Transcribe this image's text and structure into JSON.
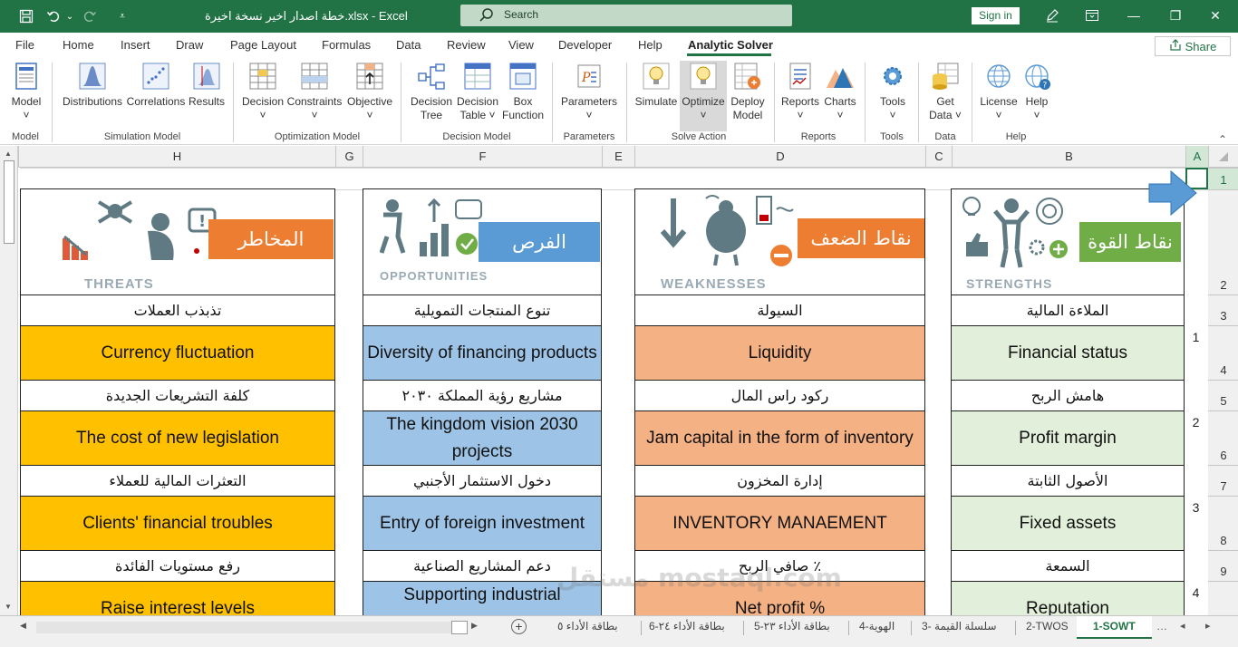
{
  "titlebar": {
    "title": "خطة اصدار اخير نسخة اخيرة.xlsx  -  Excel",
    "search_placeholder": "Search",
    "signin_label": "Sign in",
    "minimize": "—",
    "restore": "❐",
    "close": "✕"
  },
  "tabs": [
    "File",
    "Home",
    "Insert",
    "Draw",
    "Page Layout",
    "Formulas",
    "Data",
    "Review",
    "View",
    "Developer",
    "Help",
    "Analytic Solver"
  ],
  "active_tab": "Analytic Solver",
  "share_label": "Share",
  "ribbon": {
    "model": "Model",
    "distributions": "Distributions",
    "correlations": "Correlations",
    "results": "Results",
    "decision": "Decision",
    "constraints": "Constraints",
    "objective": "Objective",
    "decision_tree_1": "Decision",
    "decision_tree_2": "Tree",
    "decision_table_1": "Decision",
    "decision_table_2": "Table ˅",
    "box_function_1": "Box",
    "box_function_2": "Function",
    "parameters": "Parameters",
    "simulate": "Simulate",
    "optimize": "Optimize",
    "deploy_1": "Deploy",
    "deploy_2": "Model",
    "reports": "Reports",
    "charts": "Charts",
    "tools": "Tools",
    "get_data_1": "Get",
    "get_data_2": "Data ˅",
    "license": "License",
    "help": "Help",
    "groups": {
      "model": "Model",
      "simulation": "Simulation Model",
      "optimization": "Optimization Model",
      "decision": "Decision Model",
      "parameters": "Parameters",
      "solve": "Solve Action",
      "reports": "Reports",
      "tools": "Tools",
      "data": "Data",
      "help": "Help"
    }
  },
  "columns": [
    "H",
    "G",
    "F",
    "E",
    "D",
    "C",
    "B",
    "A"
  ],
  "rows": [
    "1",
    "2",
    "3",
    "4",
    "5",
    "6",
    "7",
    "8",
    "9"
  ],
  "headers": {
    "threats_ar": "المخاطر",
    "threats_en": "THREATS",
    "opportunities_ar": "الفرص",
    "opportunities_en": "OPPORTUNITIES",
    "weaknesses_ar": "نقاط الضعف",
    "weaknesses_en": "WEAKNESSES",
    "strengths_ar": "نقاط القوة",
    "strengths_en": "STRENGTHS"
  },
  "items": [
    {
      "num": "1",
      "threat_ar": "تذبذب العملات",
      "threat_en": "Currency fluctuation",
      "opp_ar": "تنوع المنتجات التمويلية",
      "opp_en": "Diversity of financing products",
      "weak_ar": "السيولة",
      "weak_en": "Liquidity",
      "str_ar": "الملاءة المالية",
      "str_en": "Financial status"
    },
    {
      "num": "2",
      "threat_ar": "كلفة التشريعات الجديدة",
      "threat_en": "The cost of new legislation",
      "opp_ar": "مشاريع رؤية المملكة ٢٠٣٠",
      "opp_en": "The kingdom vision 2030 projects",
      "weak_ar": "ركود راس المال",
      "weak_en": "Jam capital in the form of inventory",
      "str_ar": "هامش الربح",
      "str_en": "Profit margin"
    },
    {
      "num": "3",
      "threat_ar": "التعثرات المالية للعملاء",
      "threat_en": "Clients' financial troubles",
      "opp_ar": "دخول الاستثمار الأجنبي",
      "opp_en": "Entry of foreign investment",
      "weak_ar": "إدارة المخزون",
      "weak_en": "INVENTORY MANAEMENT",
      "str_ar": "الأصول الثابتة",
      "str_en": "Fixed assets"
    },
    {
      "num": "4",
      "threat_ar": "رفع مستويات الفائدة",
      "threat_en": "Raise interest levels",
      "opp_ar": "دعم المشاريع الصناعية",
      "opp_en": "Supporting industrial",
      "weak_ar": "صافي الربح ٪",
      "weak_en": "Net profit %",
      "str_ar": "السمعة",
      "str_en": "Reputation"
    }
  ],
  "sheets": [
    "1-SOWT",
    "2-TWOS",
    "3- سلسلة القيمة",
    "4-الهوية",
    "5-بطاقة الأداء ٢٣",
    "6-بطاقة الأداء ٢٤",
    "بطاقة الأداء ٥"
  ],
  "active_sheet": "1-SOWT",
  "watermark": "مستقل mostaql.com",
  "colors": {
    "excel_green": "#217346",
    "threat_fill": "#FFC000",
    "threat_label": "#ED7D31",
    "opp_fill": "#9DC3E6",
    "opp_label": "#5B9BD5",
    "weak_fill": "#F4B183",
    "weak_label": "#ED7D31",
    "str_fill": "#E2EFDA",
    "str_label": "#70AD47"
  }
}
